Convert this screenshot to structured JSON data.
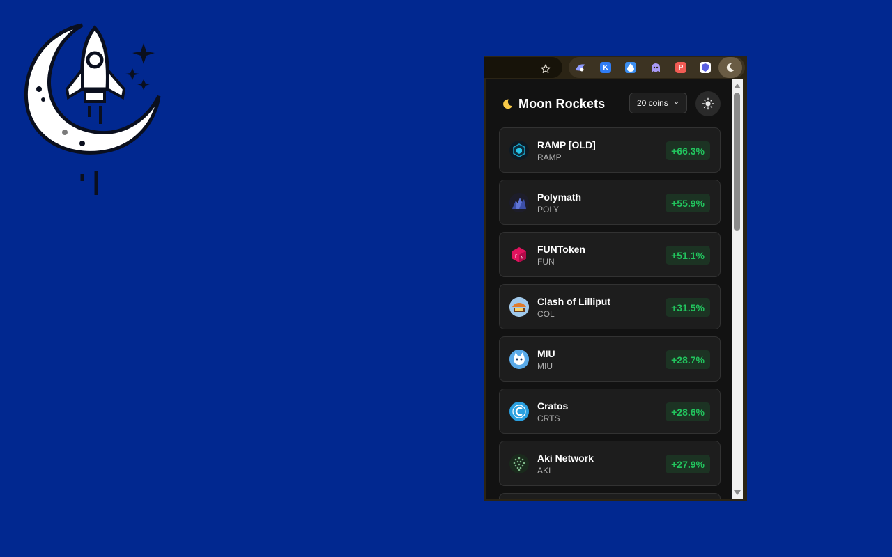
{
  "extension": {
    "title": "Moon Rockets",
    "coin_count_label": "20 coins"
  },
  "toolbar": {
    "extensions": [
      {
        "name": "shark-extension",
        "letter": "",
        "color": "#7b8cff"
      },
      {
        "name": "k-extension",
        "letter": "K",
        "color": "#2f7df6"
      },
      {
        "name": "drop-extension",
        "letter": "",
        "color": "#3b8ef0"
      },
      {
        "name": "ghost-extension",
        "letter": "",
        "color": "#9b8cf5"
      },
      {
        "name": "p-extension",
        "letter": "P",
        "color": "#f25c54"
      },
      {
        "name": "shield-extension",
        "letter": "",
        "color": "#5a5fe0"
      }
    ]
  },
  "coins": [
    {
      "name": "RAMP [OLD]",
      "symbol": "RAMP",
      "change": "+66.3%",
      "icon": "ramp-coin-icon"
    },
    {
      "name": "Polymath",
      "symbol": "POLY",
      "change": "+55.9%",
      "icon": "polymath-coin-icon"
    },
    {
      "name": "FUNToken",
      "symbol": "FUN",
      "change": "+51.1%",
      "icon": "funtoken-coin-icon"
    },
    {
      "name": "Clash of Lilliput",
      "symbol": "COL",
      "change": "+31.5%",
      "icon": "clash-of-lilliput-coin-icon"
    },
    {
      "name": "MIU",
      "symbol": "MIU",
      "change": "+28.7%",
      "icon": "miu-coin-icon"
    },
    {
      "name": "Cratos",
      "symbol": "CRTS",
      "change": "+28.6%",
      "icon": "cratos-coin-icon"
    },
    {
      "name": "Aki Network",
      "symbol": "AKI",
      "change": "+27.9%",
      "icon": "aki-network-coin-icon"
    }
  ],
  "colors": {
    "background": "#012890",
    "positive": "#22c55e",
    "card": "#1d1d1d"
  }
}
